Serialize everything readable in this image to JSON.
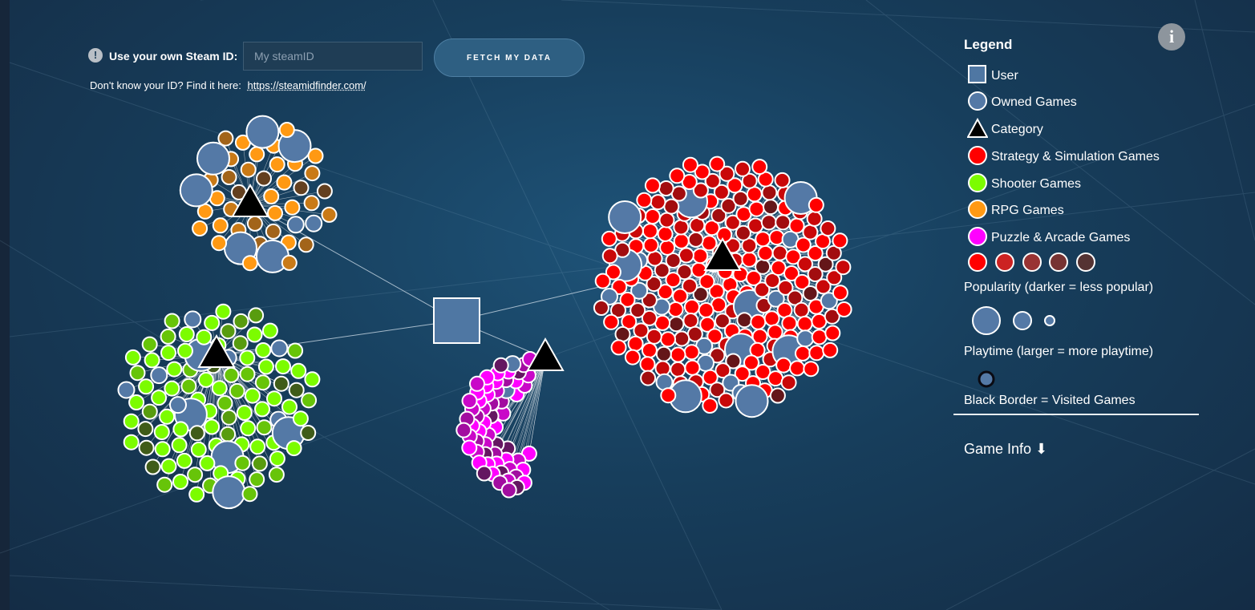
{
  "id_bar": {
    "label": "Use your own Steam ID:",
    "input_placeholder": "My steamID",
    "input_value": "",
    "fetch_button": "FETCH MY DATA",
    "help_text": "Don't know your ID? Find it here:",
    "help_link": "https://steamidfinder.com/"
  },
  "info_button": "i",
  "legend": {
    "title": "Legend",
    "items": [
      {
        "label": "User",
        "shape": "square"
      },
      {
        "label": "Owned Games",
        "shape": "circle"
      },
      {
        "label": "Category",
        "shape": "triangle"
      },
      {
        "label": "Strategy & Simulation Games",
        "shape": "circle"
      },
      {
        "label": "Shooter Games",
        "shape": "circle"
      },
      {
        "label": "RPG Games",
        "shape": "circle"
      },
      {
        "label": "Puzzle & Arcade Games",
        "shape": "circle"
      }
    ],
    "popularity_label": "Popularity (darker = less popular)",
    "playtime_label": "Playtime (larger = more playtime)",
    "visited_label": "Black Border = Visited Games",
    "game_info": "Game Info ⬇"
  },
  "colors": {
    "user": "#4f77a3",
    "owned": "#5479a6",
    "category": "#000000",
    "strategy": "#ff0000",
    "shooter": "#7cfc00",
    "rpg": "#ff9913",
    "puzzle": "#ff00ff",
    "popularity_scale": [
      "#ff0000",
      "#cc2222",
      "#993333",
      "#773333",
      "#553333"
    ]
  },
  "graph": {
    "user": {
      "label": "User"
    },
    "categories": [
      {
        "name": "RPG Games",
        "color_key": "rpg",
        "game_count": 46,
        "owned_count": 9
      },
      {
        "name": "Shooter Games",
        "color_key": "shooter",
        "game_count": 104,
        "owned_count": 12
      },
      {
        "name": "Puzzle & Arcade Games",
        "color_key": "puzzle",
        "game_count": 62,
        "owned_count": 3
      },
      {
        "name": "Strategy & Simulation Games",
        "color_key": "strategy",
        "game_count": 230,
        "owned_count": 22
      }
    ]
  }
}
